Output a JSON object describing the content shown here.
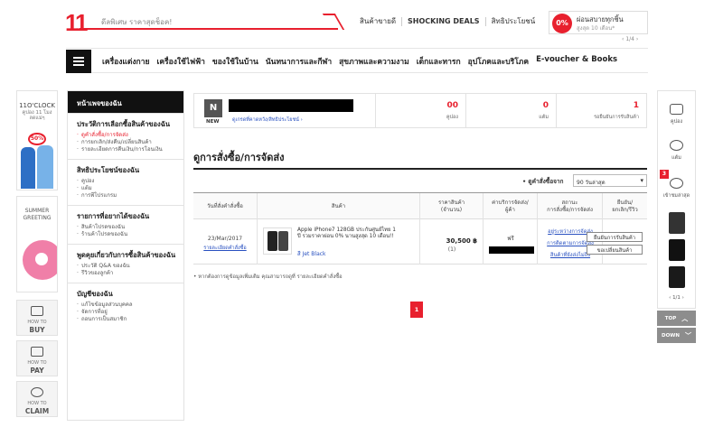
{
  "header": {
    "logo": "11",
    "search_placeholder": "ดีลพิเศษ ราคาสุดช็อค!",
    "top_links": [
      "สินค้าขายดี",
      "SHOCKING DEALS",
      "สิทธิประโยชน์"
    ],
    "promo_badge": "0%",
    "promo_text": "ผ่อนสบายทุกชิ้น",
    "promo_sub": "สูงสุด 10 เดือน*",
    "promo_pager": "1/4"
  },
  "nav": {
    "items": [
      "เครื่องแต่งกาย",
      "เครื่องใช้ไฟฟ้า",
      "ของใช้ในบ้าน",
      "นันทนาการและกีฬา",
      "สุขภาพและความงาม",
      "เด็กและทารก",
      "อุปโภคและบริโภค",
      "E-voucher & Books"
    ]
  },
  "left_rail": {
    "clock_title": "11O'CLOCK",
    "clock_sub1": "คูปอง 11 โมง",
    "clock_sub2": "ลดแม่ๆ",
    "clock_pct": "50%",
    "summer": [
      "SUMMER",
      "GREETING"
    ],
    "how_buy": {
      "l1": "HOW TO",
      "l2": "BUY"
    },
    "how_pay": {
      "l1": "HOW TO",
      "l2": "PAY"
    },
    "how_claim": {
      "l1": "HOW TO",
      "l2": "CLAIM"
    }
  },
  "sidebar": {
    "header": "หน้าเพจของฉัน",
    "sections": [
      {
        "title": "ประวัติการเลือกซื้อสินค้าของฉัน",
        "items": [
          "ดูคำสั่งซื้อ/การจัดส่ง",
          "การยกเลิก/ส่งคืน/เปลี่ยนสินค้า",
          "รายละเอียดการคืนเงิน/การโอนเงิน"
        ]
      },
      {
        "title": "สิทธิประโยชน์ของฉัน",
        "items": [
          "คูปอง",
          "แต้ม",
          "การพีโปรแกรม"
        ]
      },
      {
        "title": "รายการที่อยากได้ของฉัน",
        "items": [
          "สินค้าโปรดของฉัน",
          "ร้านค้าโปรดของฉัน"
        ]
      },
      {
        "title": "พูดคุยเกี่ยวกับการซื้อสินค้าของฉัน",
        "items": [
          "ประวัติ Q&A ของฉัน",
          "รีวิวของลูกค้า"
        ]
      },
      {
        "title": "บัญชีของฉัน",
        "items": [
          "แก้ไขข้อมูลส่วนบุคคล",
          "จัดการที่อยู่",
          "ถอนการเป็นสมาชิก"
        ]
      }
    ]
  },
  "summary": {
    "grade": "N",
    "grade_label": "NEW",
    "grade_link": "ดูเกรดที่คาดหวัง/สิทธิประโยชน์ ›",
    "stats": [
      {
        "value": "00",
        "label": "คูปอง"
      },
      {
        "value": "0",
        "label": "แต้ม"
      },
      {
        "value": "1",
        "label": "รอยืนยันการรับสินค้า"
      }
    ]
  },
  "orders": {
    "title": "ดูการสั่งซื้อ/การจัดส่ง",
    "filter_label": "ดูคำสั่งซื้อจาก",
    "filter_value": "90 วันล่าสุด",
    "columns": [
      "วันที่สั่งคำสั่งซื้อ",
      "สินค้า",
      "ราคาสินค้า\n(จำนวน)",
      "ค่าบริการจัดส่ง/\nผู้ค้า",
      "สถานะ\nการสั่งซื้อ/การจัดส่ง",
      "ยืนยัน/\nยกเลิก/รีวิว"
    ],
    "rows": [
      {
        "date": "23/Mar/2017",
        "detail_link": "รายละเอียดคำสั่งซื้อ",
        "product": "Apple iPhone7 128GB ประกันศูนย์ไทย 1 ปี รวมราคาผ่อน 0% นานสูงสุด 10 เดือน!!",
        "option": "สี Jet Black",
        "price": "30,500 ฿",
        "qty": "(1)",
        "shipping": "ฟรี",
        "status": [
          "อยู่ระหว่างการจัดส่ง",
          "การติดตามการจัดส่ง",
          "สินค้าที่ยังส่งไม่ถึง"
        ],
        "actions": [
          "ยืนยันการรับสินค้า",
          "ขอเปลี่ยนสินค้า"
        ]
      }
    ],
    "note": "• หากต้องการดูข้อมูลเพิ่มเติม คุณสามารถดูที่ รายละเอียดคำสั่งซื้อ",
    "page": "1"
  },
  "right_rail": {
    "coupon": "คูปอง",
    "points": "แต้ม",
    "recent_badge": "3",
    "recent": "เข้าชมล่าสุด",
    "pager": "1/1",
    "top": "TOP",
    "down": "DOWN"
  }
}
